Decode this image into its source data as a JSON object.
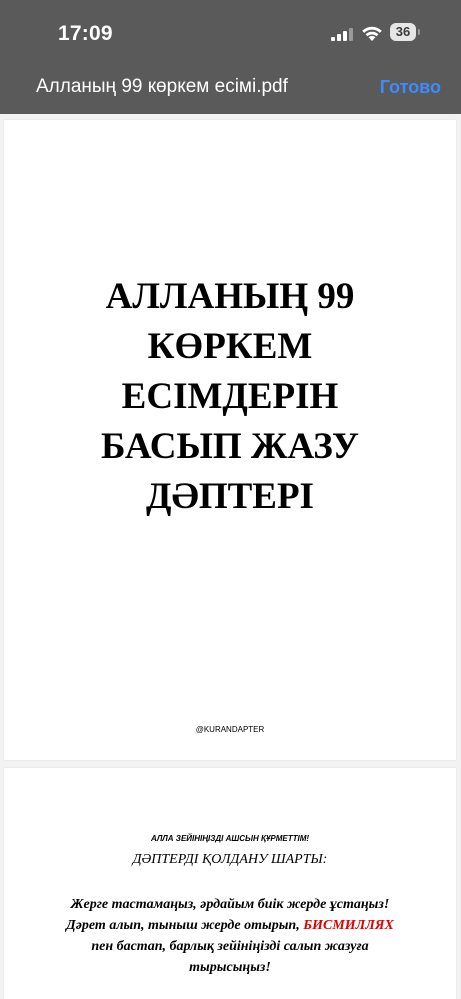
{
  "status_bar": {
    "time": "17:09",
    "battery_level": "36",
    "icons": [
      "signal-icon",
      "wifi-icon",
      "battery-icon"
    ]
  },
  "nav_bar": {
    "title": "Алланың 99 көркем есімі.pdf",
    "done_label": "Готово"
  },
  "colors": {
    "header_bg": "#5a5a5a",
    "done_accent": "#3c8cff",
    "highlight_red": "#e00000"
  },
  "pages": {
    "cover": {
      "title_lines": [
        "АЛЛАНЫҢ 99",
        "КӨРКЕМ",
        "ЕСІМДЕРІН",
        "БАСЫП ЖАЗУ",
        "ДӘПТЕРІ"
      ],
      "handle": "@KURANDAPTER"
    },
    "rules": {
      "greeting": "АЛЛА  ЗЕЙІНІҢІЗДІ АШСЫН ҚҰРМЕТТІМ!",
      "heading": "ДӘПТЕРДІ ҚОЛДАНУ ШАРТЫ:",
      "line1": "Жерге тастамаңыз, әрдайым биік жерде ұстаңыз!",
      "line2_before": "Дәрет алып, тыныш жерде отырып, ",
      "line2_highlight": "БИСМИЛЛЯХ",
      "line3": "пен  бастап, барлық зейініңізді салып жазуға",
      "line4": "тырысыңыз!"
    }
  }
}
